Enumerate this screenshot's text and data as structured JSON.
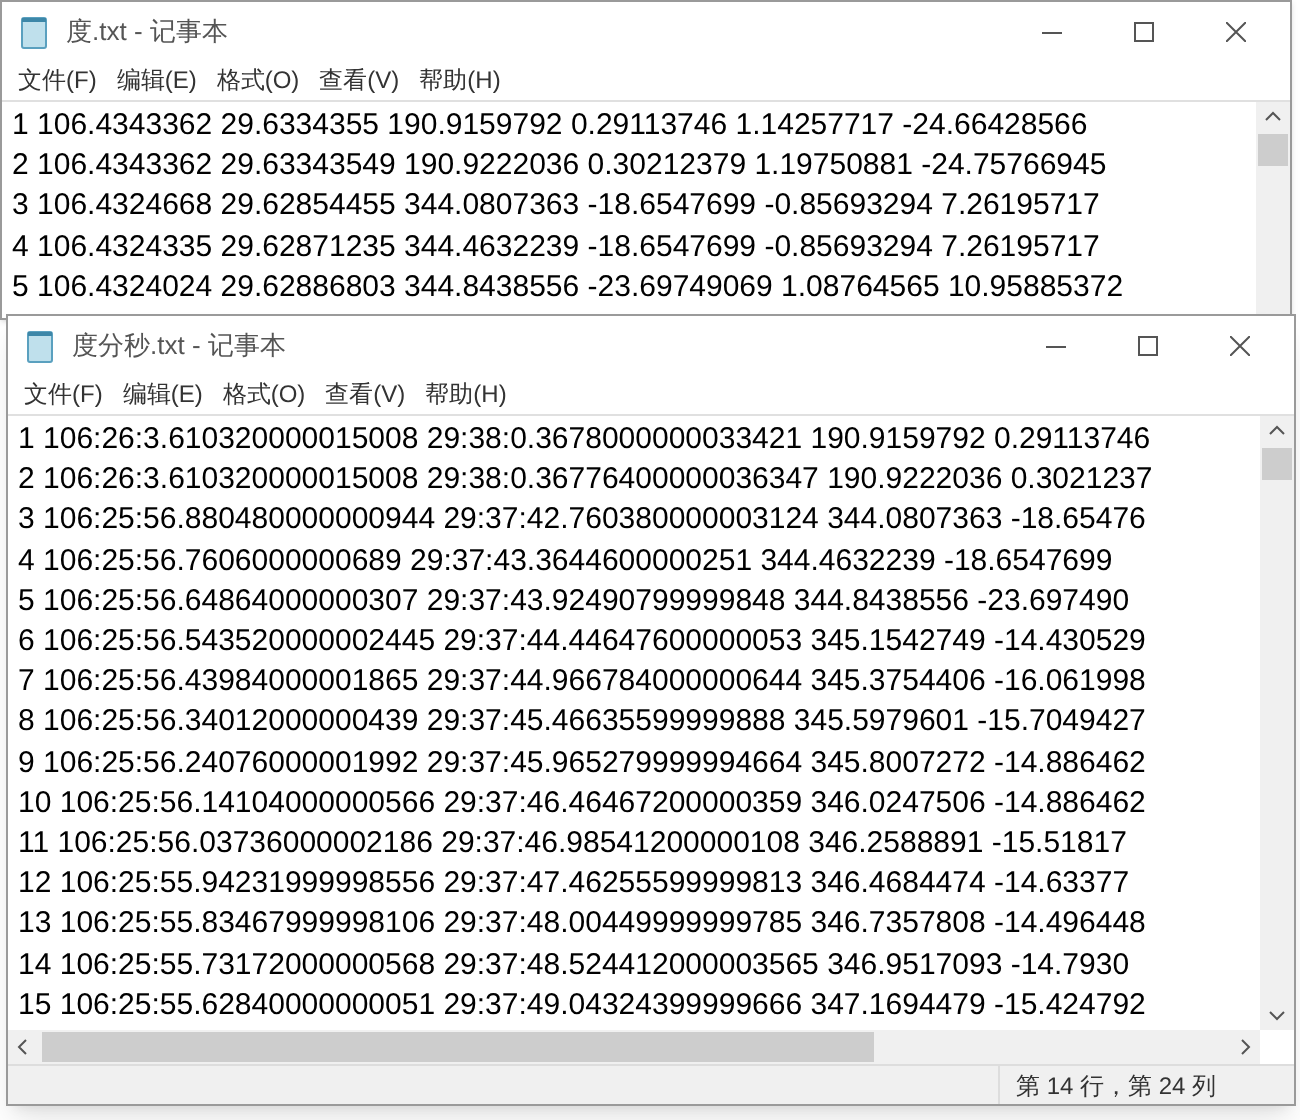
{
  "windows": [
    {
      "title": "度.txt - 记事本",
      "menu": [
        "文件(F)",
        "编辑(E)",
        "格式(O)",
        "查看(V)",
        "帮助(H)"
      ],
      "lines": [
        "1 106.4343362 29.6334355 190.9159792 0.29113746 1.14257717 -24.66428566",
        "2 106.4343362 29.63343549 190.9222036 0.30212379 1.19750881 -24.75766945",
        "3 106.4324668 29.62854455 344.0807363 -18.6547699 -0.85693294 7.26195717",
        "4 106.4324335 29.62871235 344.4632239 -18.6547699 -0.85693294 7.26195717",
        "5 106.4324024 29.62886803 344.8438556 -23.69749069 1.08764565 10.95885372"
      ]
    },
    {
      "title": "度分秒.txt - 记事本",
      "menu": [
        "文件(F)",
        "编辑(E)",
        "格式(O)",
        "查看(V)",
        "帮助(H)"
      ],
      "lines": [
        "1 106:26:3.610320000015008 29:38:0.3678000000033421 190.9159792 0.29113746",
        "2 106:26:3.610320000015008 29:38:0.36776400000036347 190.9222036 0.3021237",
        "3 106:25:56.880480000000944 29:37:42.760380000003124 344.0807363 -18.65476",
        "4 106:25:56.7606000000689 29:37:43.3644600000251 344.4632239 -18.6547699",
        "5 106:25:56.64864000000307 29:37:43.92490799999848 344.8438556 -23.697490",
        "6 106:25:56.543520000002445 29:37:44.44647600000053 345.1542749 -14.430529",
        "7 106:25:56.43984000001865 29:37:44.966784000000644 345.3754406 -16.061998",
        "8 106:25:56.34012000000439 29:37:45.46635599999888 345.5979601 -15.7049427",
        "9 106:25:56.24076000001992 29:37:45.965279999994664 345.8007272 -14.886462",
        "10 106:25:56.14104000000566 29:37:46.46467200000359 346.0247506 -14.886462",
        "11 106:25:56.03736000002186 29:37:46.98541200000108 346.2588891 -15.51817",
        "12 106:25:55.94231999998556 29:37:47.46255599999813 346.4684474 -14.63377",
        "13 106:25:55.83467999998106 29:37:48.00449999999785 346.7357808 -14.496448",
        "14 106:25:55.73172000000568 29:37:48.524412000003565 346.9517093 -14.7930",
        "15 106:25:55.62840000000051 29:37:49.04324399999666 347.1694479 -15.424792"
      ],
      "status_bar": "第 14 行，第 24 列"
    }
  ]
}
